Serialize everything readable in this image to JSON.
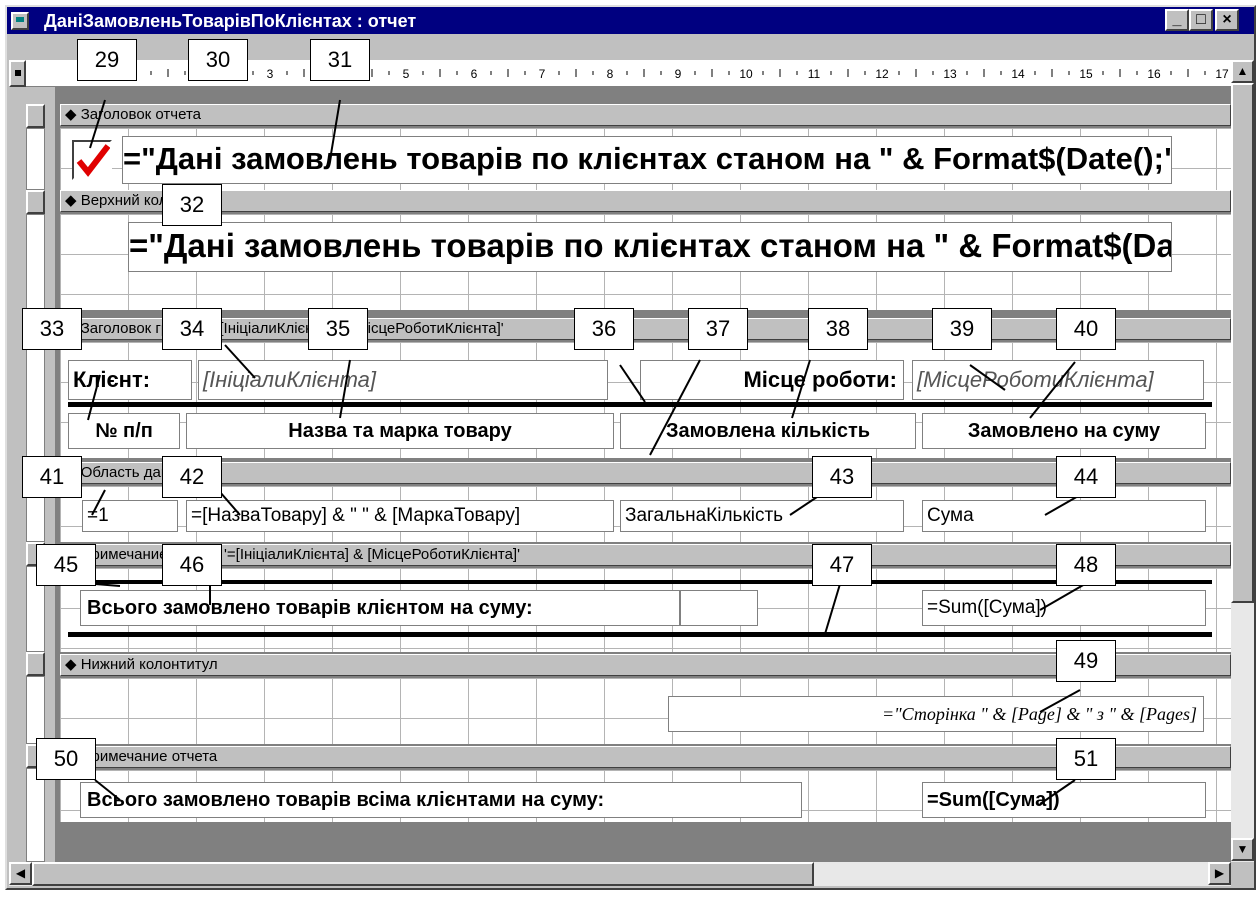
{
  "window": {
    "title": "ДаніЗамовленьТоварівПоКлієнтах : отчет",
    "btn_min": "_",
    "btn_max": "□",
    "btn_close": "×"
  },
  "ruler": {
    "marks": [
      "1",
      "2",
      "3",
      "4",
      "5",
      "6",
      "7",
      "8",
      "9",
      "10",
      "11",
      "12",
      "13",
      "14",
      "15",
      "16",
      "17"
    ]
  },
  "sections": {
    "report_header": "Заголовок отчета",
    "page_header": "Верхний колонтитул",
    "group_header": "Заголовок группы '=[ІніціалиКлієнта] & [МісцеРоботиКлієнта]'",
    "detail": "Область данных",
    "group_footer": "Примечание группы '=[ІніціалиКлієнта] & [МісцеРоботиКлієнта]'",
    "page_footer": "Нижний колонтитул",
    "report_footer": "Примечание отчета"
  },
  "controls": {
    "report_title": "=\"Дані замовлень товарів по клієнтах станом на \" & Format$(Date();\"dd.mm.yyyy\")",
    "page_title": "=\"Дані замовлень товарів по клієнтах станом на \" & Format$(Date();\"dd.mm.yyyy\")",
    "client_label": "Клієнт:",
    "client_value": "[ІніціалиКлієнта]",
    "work_label": "Місце роботи:",
    "work_value": "[МісцеРоботиКлієнта]",
    "col_num": "№ п/п",
    "col_name": "Назва та марка товару",
    "col_qty": "Замовлена кількість",
    "col_sum": "Замовлено на суму",
    "detail_num": "=1",
    "detail_name": "=[НазваТовару] & \" \" & [МаркаТовару]",
    "detail_qty": "ЗагальнаКількість",
    "detail_sum": "Сума",
    "group_total_label": "Всього замовлено товарів клієнтом на суму:",
    "group_total_value": "=Sum([Сума])",
    "page_formula": "=\"Сторінка \" & [Page] & \" з \" & [Pages]",
    "report_total_label": "Всього замовлено товарів всіма клієнтами на суму:",
    "report_total_value": "=Sum([Сума])"
  },
  "callouts": [
    "29",
    "30",
    "31",
    "32",
    "33",
    "34",
    "35",
    "36",
    "37",
    "38",
    "39",
    "40",
    "41",
    "42",
    "43",
    "44",
    "45",
    "46",
    "47",
    "48",
    "49",
    "50",
    "51"
  ],
  "icons": {
    "checkbox": "checked-checkbox-icon",
    "band_marker": "band-arrow-icon"
  },
  "colors": {
    "titlebar": "#000080",
    "checkmark": "#e00000"
  }
}
